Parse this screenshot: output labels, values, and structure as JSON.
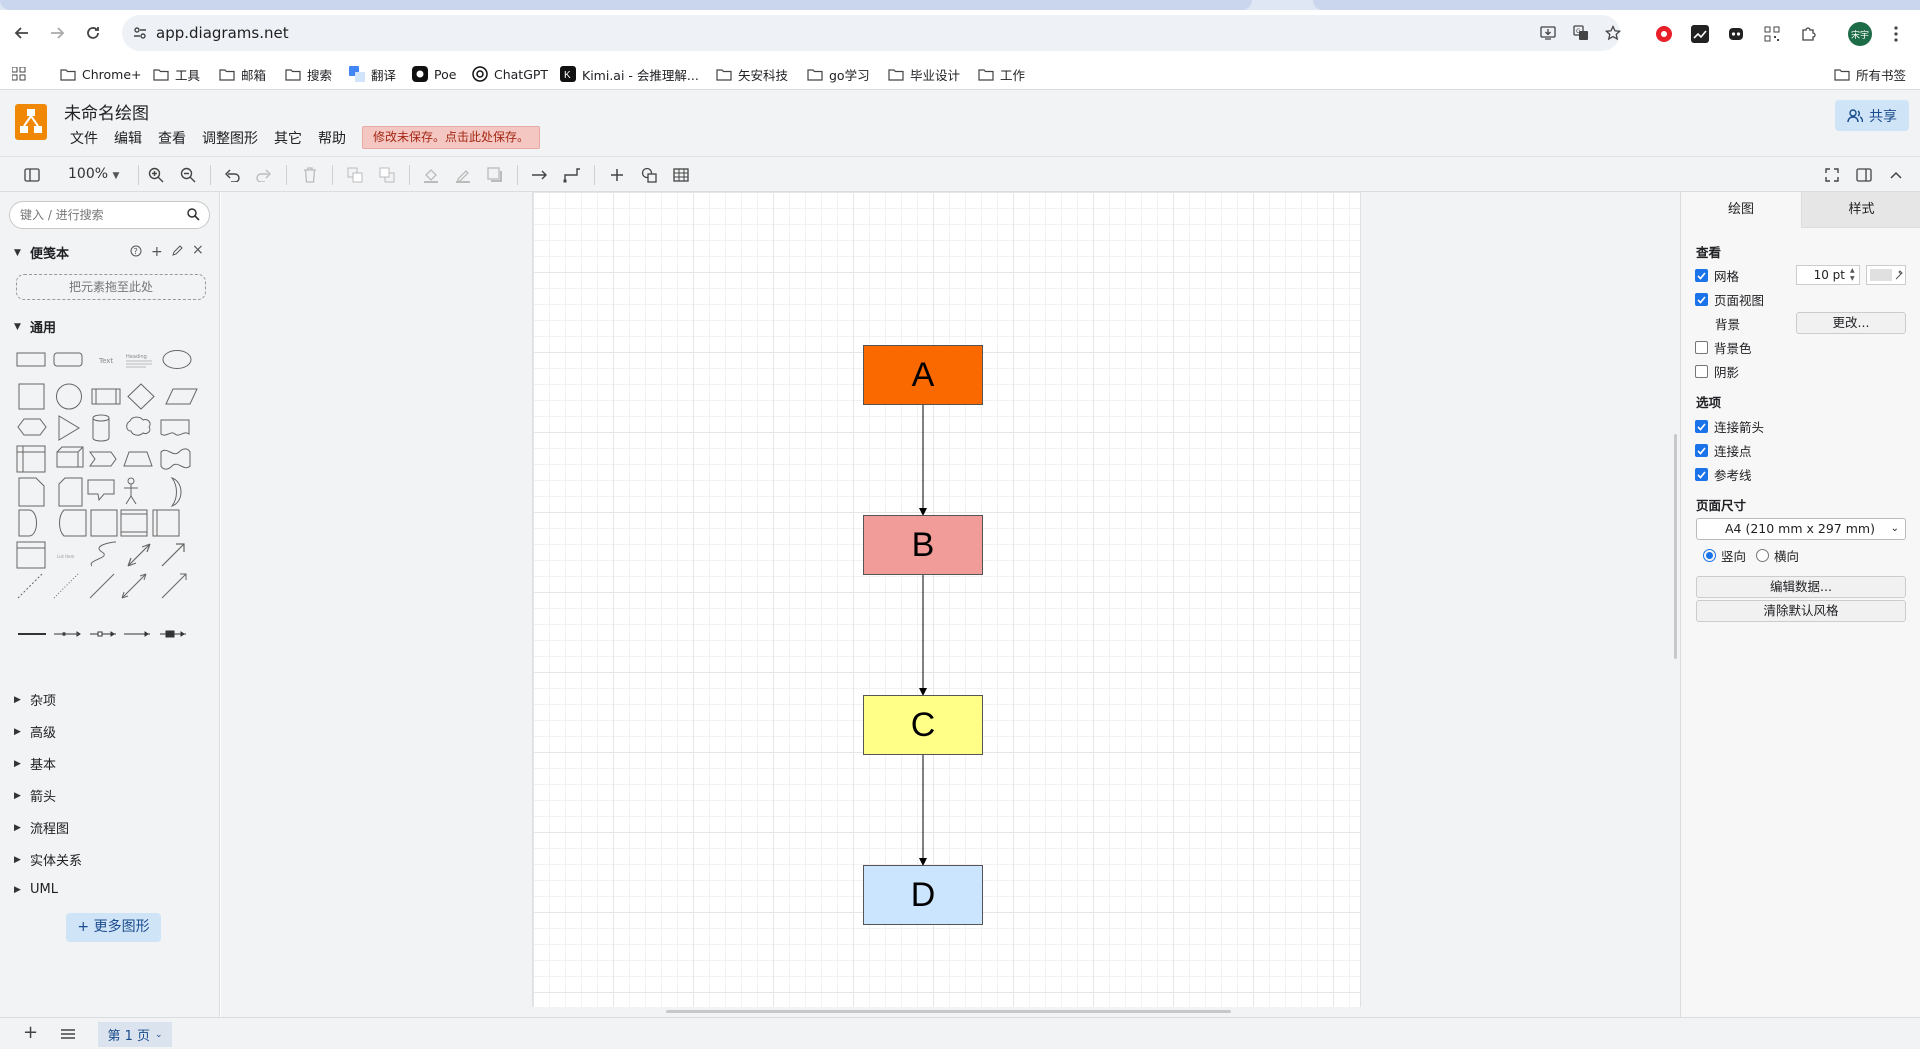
{
  "browser": {
    "url": "app.diagrams.net",
    "bookmarks": [
      "Chrome+",
      "工具",
      "邮箱",
      "搜索",
      "翻译",
      "Poe",
      "ChatGPT",
      "Kimi.ai - 会推理解...",
      "矢安科技",
      "go学习",
      "毕业设计",
      "工作"
    ],
    "all_bookmarks": "所有书签",
    "profile_initial": "宋宇"
  },
  "app": {
    "title": "未命名绘图",
    "menus": [
      "文件",
      "编辑",
      "查看",
      "调整图形",
      "其它",
      "帮助"
    ],
    "unsaved_notice": "修改未保存。点击此处保存。",
    "share": "共享"
  },
  "toolbar": {
    "zoom": "100%"
  },
  "left_panel": {
    "search_placeholder": "键入 / 进行搜索",
    "scratchpad": "便笺本",
    "drop_hint": "把元素拖至此处",
    "general": "通用",
    "shape_text": "Text",
    "shape_heading": "Heading",
    "shape_listitem": "List Item",
    "libraries": [
      "杂项",
      "高级",
      "基本",
      "箭头",
      "流程图",
      "实体关系",
      "UML"
    ],
    "more_shapes": "+ 更多图形"
  },
  "diagram": {
    "nodes": [
      {
        "label": "A",
        "fill": "#fa6800"
      },
      {
        "label": "B",
        "fill": "#f19c99"
      },
      {
        "label": "C",
        "fill": "#ffff88"
      },
      {
        "label": "D",
        "fill": "#cce5ff"
      }
    ]
  },
  "right_panel": {
    "tabs": [
      "绘图",
      "样式"
    ],
    "view_label": "查看",
    "grid": "网格",
    "grid_size": "10 pt",
    "page_view": "页面视图",
    "background": "背景",
    "change": "更改...",
    "bg_color": "背景色",
    "shadow": "阴影",
    "options_label": "选项",
    "connection_arrows": "连接箭头",
    "connection_points": "连接点",
    "guides": "参考线",
    "page_size_label": "页面尺寸",
    "page_size": "A4 (210 mm x 297 mm)",
    "portrait": "竖向",
    "landscape": "横向",
    "edit_data": "编辑数据...",
    "clear_style": "清除默认风格"
  },
  "bottom": {
    "page_tab": "第 1 页"
  }
}
